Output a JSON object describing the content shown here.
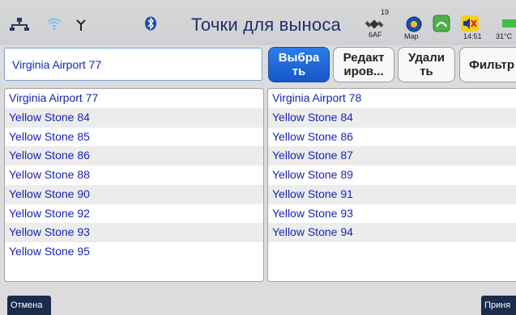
{
  "header": {
    "title": "Точки для выноса",
    "satellite_count": "19",
    "satellite_mode": "6AF",
    "map_label": "Map",
    "time": "14:51",
    "temperature": "31°C"
  },
  "selected_point": "Virginia Airport 77",
  "buttons": {
    "select": "Выбра\nть",
    "edit": "Редакт\nиров...",
    "delete": "Удали\nть",
    "filter": "Фильтр"
  },
  "left_list": [
    "Virginia Airport 77",
    "Yellow Stone 84",
    "Yellow Stone 85",
    "Yellow Stone 86",
    "Yellow Stone 88",
    "Yellow Stone 90",
    "Yellow Stone 92",
    "Yellow Stone 93",
    "Yellow Stone 95"
  ],
  "right_list": [
    "Virginia Airport 78",
    "Yellow Stone 84",
    "Yellow Stone 86",
    "Yellow Stone 87",
    "Yellow Stone 89",
    "Yellow Stone 91",
    "Yellow Stone 93",
    "Yellow Stone 94"
  ],
  "footer": {
    "cancel": "Отмена",
    "accept": "Приня"
  },
  "colors": {
    "accent": "#1a5ad0",
    "list_text": "#1a22b4",
    "footer_button": "#1b2b4a"
  },
  "icons": [
    "network-icon",
    "wifi-icon",
    "antenna-icon",
    "bluetooth-icon",
    "satellite-icon",
    "map-icon",
    "screen-icon",
    "mute-icon",
    "battery-icon"
  ]
}
